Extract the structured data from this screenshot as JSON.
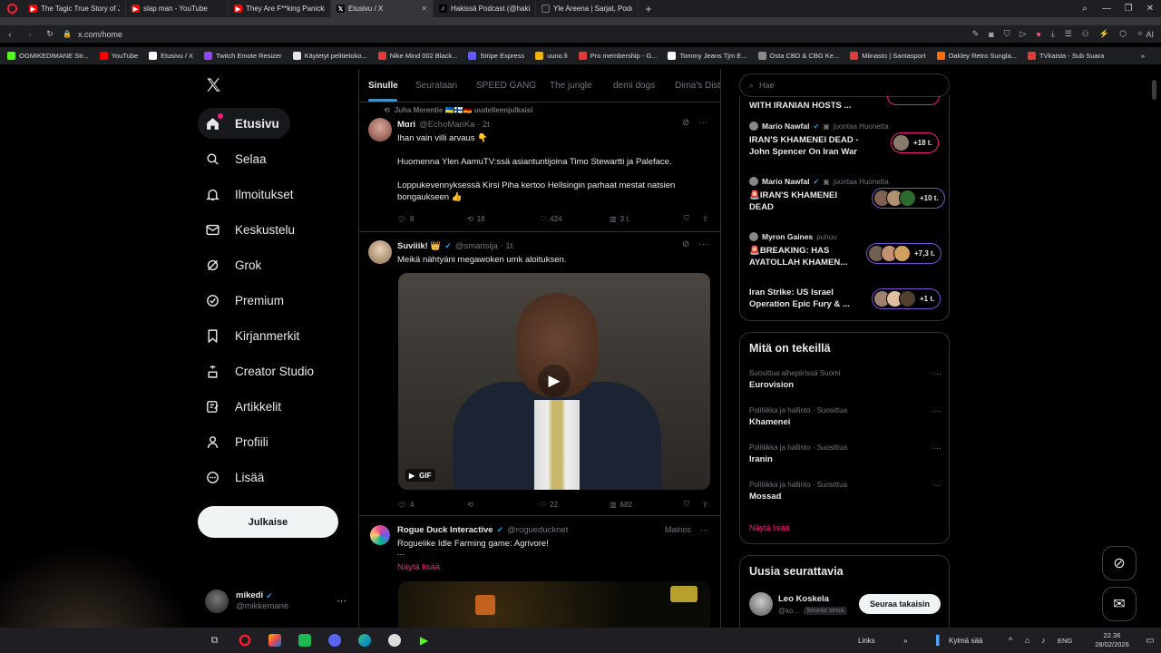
{
  "browser": {
    "tabs": [
      {
        "title": "The Tagic True Story of Ju",
        "color": "#ff0000"
      },
      {
        "title": "slap man - YouTube",
        "color": "#ff0000"
      },
      {
        "title": "They Are F**king Panickin",
        "color": "#ff0000"
      },
      {
        "title": "Etusivu / X",
        "color": "#000000"
      },
      {
        "title": "Hakissä Podcast (@hakiss",
        "color": "#000000"
      },
      {
        "title": "Yle Areena | Sarjat, Podcas",
        "color": "#1a1a1a"
      }
    ],
    "url": "x.com/home",
    "ai_label": "AI",
    "bookmarks": [
      {
        "label": "OGMIKEDIMANE Str...",
        "color": "#53fc18"
      },
      {
        "label": "YouTube",
        "color": "#ff0000"
      },
      {
        "label": "Etusivu / X",
        "color": "#ffffff"
      },
      {
        "label": "Twitch Emote Resizer",
        "color": "#9146ff"
      },
      {
        "label": "Käytetyt pelitietoko...",
        "color": "#e6e6e6"
      },
      {
        "label": "Nike Mind 002 Black...",
        "color": "#e53935"
      },
      {
        "label": "Stripe Express",
        "color": "#635bff"
      },
      {
        "label": "uuno.fi",
        "color": "#f4b400"
      },
      {
        "label": "Pro membership - G...",
        "color": "#e53935"
      },
      {
        "label": "Tommy Jeans Tjm E...",
        "color": "#ffffff"
      },
      {
        "label": "Osta CBD & CBG Ke...",
        "color": "#888888"
      },
      {
        "label": "Miinasto | Santasport",
        "color": "#e53935"
      },
      {
        "label": "Oakley Retro Sungla...",
        "color": "#ff6d00"
      },
      {
        "label": "TVkaista - Sub Suara",
        "color": "#e53935"
      }
    ]
  },
  "sidebar": {
    "items": [
      {
        "label": "Etusivu",
        "icon": "home-icon"
      },
      {
        "label": "Selaa",
        "icon": "search-icon"
      },
      {
        "label": "Ilmoitukset",
        "icon": "bell-icon"
      },
      {
        "label": "Keskustelu",
        "icon": "mail-icon"
      },
      {
        "label": "Grok",
        "icon": "grok-icon"
      },
      {
        "label": "Premium",
        "icon": "verified-icon"
      },
      {
        "label": "Kirjanmerkit",
        "icon": "bookmark-icon"
      },
      {
        "label": "Creator Studio",
        "icon": "creator-icon"
      },
      {
        "label": "Artikkelit",
        "icon": "article-icon"
      },
      {
        "label": "Profiili",
        "icon": "person-icon"
      },
      {
        "label": "Lisää",
        "icon": "more-icon"
      }
    ],
    "post_button": "Julkaise",
    "account": {
      "name": "mikedi",
      "handle": "@mikkemane"
    }
  },
  "feed": {
    "tabs": [
      "Sinulle",
      "Seurataan",
      "SPEED GANG",
      "The jungle",
      "demi dogs",
      "Dima's Dist"
    ],
    "tweets": [
      {
        "repost_by": "Juha Merentie 🇺🇦🇫🇮🇩🇪 uudelleenjulkaisi",
        "name": "Mɑri",
        "handle": "@EchoMariKa · 2t",
        "text": [
          "Ihan vain villi arvaus 👇",
          "",
          "Huomenna Ylen AamuTV:ssä asiantuntijoina Timo Stewartti ja Paleface.",
          "",
          "Loppukevennyksessä Kirsi Piha kertoo Hellsingin parhaat mestat natsien bongaukseen 👍"
        ],
        "replies": "8",
        "reposts": "18",
        "likes": "424",
        "views": "3 t."
      },
      {
        "name": "Suviiik! 👑",
        "handle": "@smarisija · 1t",
        "text": [
          "Meikä nähtyäni megawoken umk aloituksen."
        ],
        "gif_label": "GIF",
        "replies": "4",
        "reposts": "",
        "likes": "22",
        "views": "682"
      },
      {
        "name": "Rogue Duck Interactive",
        "handle": "@rogueducknet",
        "ad_label": "Mainos",
        "text": [
          "Roguelike Idle Farming game: Agrivore!",
          "..."
        ],
        "show_more": "Näytä lisää"
      }
    ]
  },
  "right": {
    "search_placeholder": "Hae",
    "news_top_cut": "WITH IRANIAN HOSTS ...",
    "news": [
      {
        "author": "Mario Nawfal",
        "meta": "juontaa Huonetta",
        "title": [
          "IRAN'S KHAMENEI DEAD -",
          "John Spencer On Iran War"
        ],
        "count": "+18 t.",
        "border": "#f91880"
      },
      {
        "author": "Mario Nawfal",
        "meta": "juontaa Huonetta",
        "title": [
          "🚨IRAN'S KHAMENEI",
          "DEAD"
        ],
        "count": "+10 t.",
        "border": "#7b4fd0"
      },
      {
        "author": "Myron Gaines",
        "meta": "puhuu",
        "title": [
          "🚨BREAKING: HAS",
          "AYATOLLAH KHAMEN..."
        ],
        "count": "+7,3 t.",
        "border": "#7b4fd0"
      },
      {
        "author": "",
        "meta": "",
        "title": [
          "Iran Strike: US Israel",
          "Operation Epic Fury & ..."
        ],
        "count": "+1 t.",
        "border": "#7b4fd0"
      }
    ],
    "trends_title": "Mitä on tekeillä",
    "trends": [
      {
        "category": "Suosittua aihepiirissä Suomi",
        "name": "Eurovision"
      },
      {
        "category": "Politiikka ja hallinto · Suosittua",
        "name": "Khamenei"
      },
      {
        "category": "Politiikka ja hallinto · Suosittua",
        "name": "Iranin"
      },
      {
        "category": "Politiikka ja hallinto · Suosittua",
        "name": "Mossad"
      }
    ],
    "trends_more": "Näytä lisää",
    "follow_title": "Uusia seurattavia",
    "follow": {
      "name": "Leo Koskela",
      "handle": "@ko...",
      "badge": "Seuraa sinua",
      "button": "Seuraa takaisin"
    }
  },
  "taskbar": {
    "links": "Links",
    "weather": "Kylmä sää",
    "lang": "ENG",
    "time": "22.36",
    "date": "28/02/2026"
  },
  "colors": {
    "accent": "#1d9bf0",
    "pink": "#f91880",
    "bg": "#000000",
    "border": "#2f3336"
  }
}
